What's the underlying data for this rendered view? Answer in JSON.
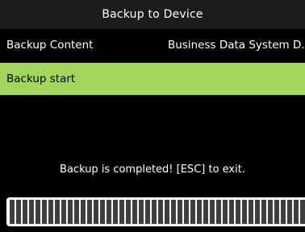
{
  "header": {
    "title": "Backup to Device"
  },
  "menu": {
    "content_label": "Backup Content",
    "content_value": "Business Data System D...",
    "start_label": "Backup start"
  },
  "status": {
    "message": "Backup is completed! [ESC] to exit."
  },
  "progress": {
    "percent": 100
  },
  "colors": {
    "highlight": "#a3d65b",
    "background": "#000000",
    "title_bar": "#1c1c1c",
    "progress_segment": "#3e3e3e"
  }
}
